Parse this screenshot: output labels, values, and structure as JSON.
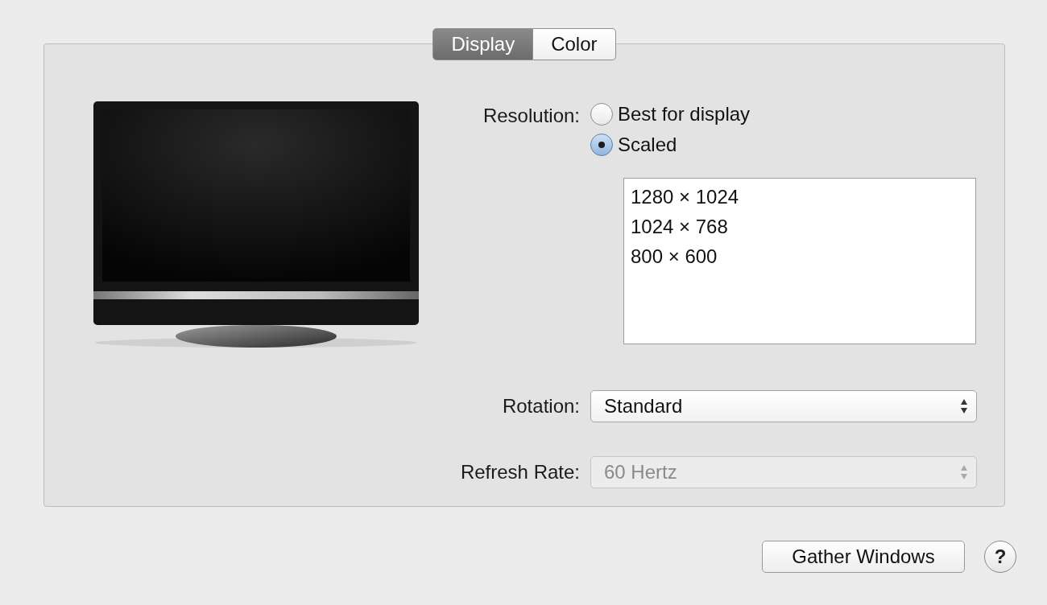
{
  "tabs": [
    {
      "label": "Display",
      "selected": true
    },
    {
      "label": "Color",
      "selected": false
    }
  ],
  "resolution": {
    "label": "Resolution:",
    "options": [
      {
        "label": "Best for display",
        "selected": false
      },
      {
        "label": "Scaled",
        "selected": true
      }
    ]
  },
  "scaled_list": [
    "1280 × 1024",
    "1024 × 768",
    "800 × 600"
  ],
  "rotation": {
    "label": "Rotation:",
    "value": "Standard",
    "disabled": false
  },
  "refresh_rate": {
    "label": "Refresh Rate:",
    "value": "60 Hertz",
    "disabled": true
  },
  "buttons": {
    "gather": "Gather Windows",
    "help": "?"
  }
}
